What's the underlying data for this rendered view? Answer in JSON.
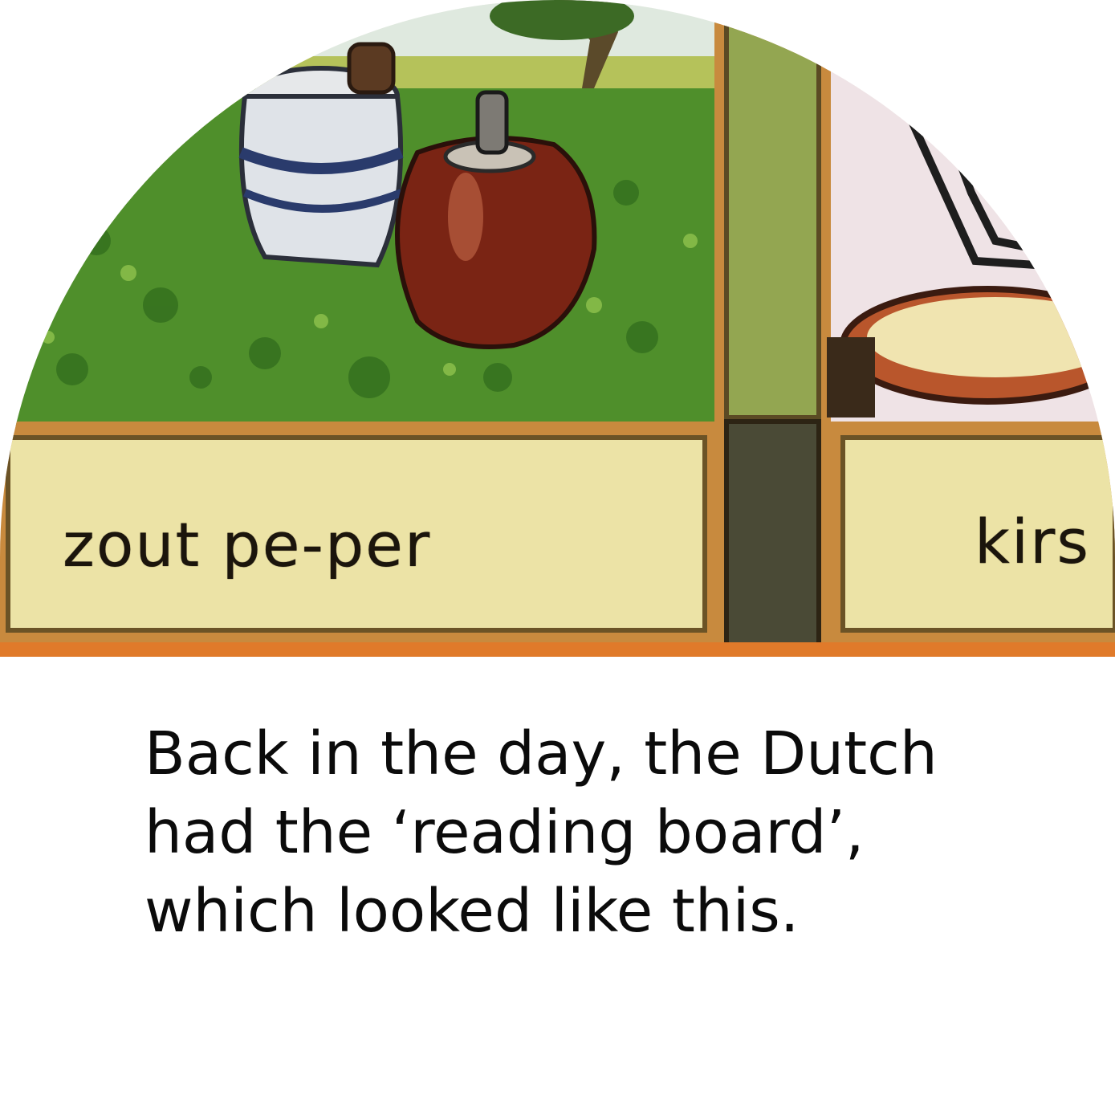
{
  "illustration": {
    "left_card_label": "zout pe-per",
    "right_card_label": "kirs",
    "colors": {
      "grass": "#4f8f2b",
      "sky": "#cfe3ef",
      "label_panel": "#ece3a6",
      "frame_brown": "#c88a3e",
      "divider_green": "#93a651",
      "pepper_mill": "#7a2414"
    }
  },
  "caption": {
    "line1": "Back in the day, the Dutch",
    "line2": "had the ‘reading board’,",
    "line3": "which looked like this."
  }
}
